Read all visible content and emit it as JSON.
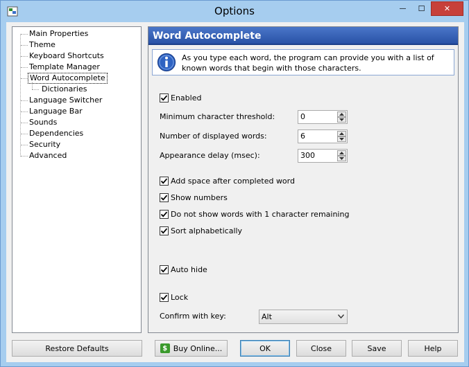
{
  "window": {
    "title": "Options",
    "controls": {
      "minimize": "—",
      "maximize": "☐",
      "close": "✕"
    }
  },
  "sidebar": {
    "items": [
      {
        "label": "Main Properties"
      },
      {
        "label": "Theme"
      },
      {
        "label": "Keyboard Shortcuts"
      },
      {
        "label": "Template Manager"
      },
      {
        "label": "Word Autocomplete",
        "selected": true
      },
      {
        "label": "Dictionaries",
        "child": true
      },
      {
        "label": "Language Switcher"
      },
      {
        "label": "Language Bar"
      },
      {
        "label": "Sounds"
      },
      {
        "label": "Dependencies"
      },
      {
        "label": "Security"
      },
      {
        "label": "Advanced"
      }
    ]
  },
  "panel": {
    "title": "Word Autocomplete",
    "info_text": "As you type each word, the program can provide you with a list of known words that begin with those characters.",
    "enabled": {
      "label": "Enabled",
      "checked": true
    },
    "min_threshold": {
      "label": "Minimum character threshold:",
      "value": "0"
    },
    "displayed_words": {
      "label": "Number of displayed words:",
      "value": "6"
    },
    "appearance_delay": {
      "label": "Appearance delay (msec):",
      "value": "300"
    },
    "add_space": {
      "label": "Add space after completed word",
      "checked": true
    },
    "show_numbers": {
      "label": "Show numbers",
      "checked": true
    },
    "no_one_char": {
      "label": "Do not show words with 1 character remaining",
      "checked": true
    },
    "sort_alpha": {
      "label": "Sort alphabetically",
      "checked": true
    },
    "auto_hide": {
      "label": "Auto hide",
      "checked": true
    },
    "lock": {
      "label": "Lock",
      "checked": true
    },
    "confirm_key": {
      "label": "Confirm with key:",
      "value": "Alt"
    }
  },
  "buttons": {
    "restore_defaults": "Restore Defaults",
    "buy_online": "Buy Online...",
    "buy_icon": "$",
    "ok": "OK",
    "close": "Close",
    "save": "Save",
    "help": "Help"
  },
  "colors": {
    "header_accent": "#2f5bb0",
    "close_button": "#c7403a",
    "frame": "#a6cdef"
  }
}
